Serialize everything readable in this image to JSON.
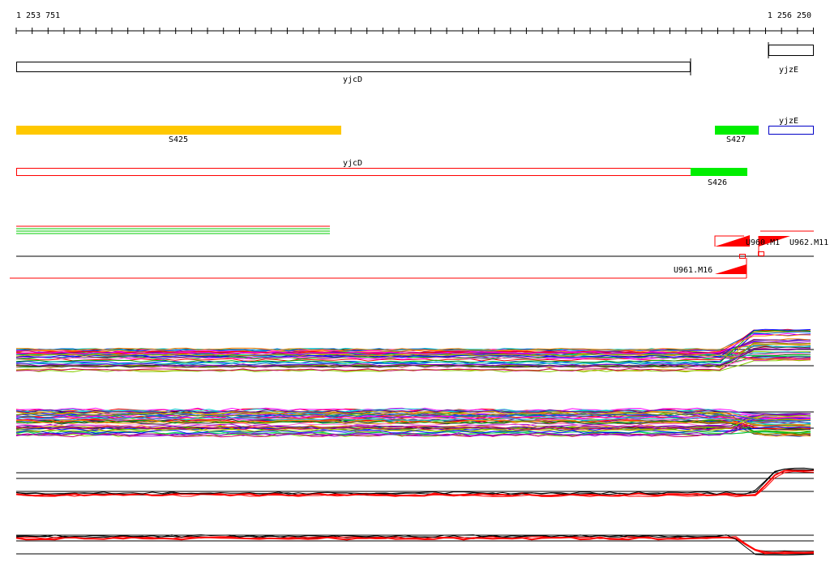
{
  "coordinates": {
    "start_label": "1 253 751",
    "end_label": "1 256 250"
  },
  "genes": {
    "top_yjcD": "yjcD",
    "top_yjzE": "yjzE",
    "yjzE_blue": "yjzE",
    "yjcD_red": "yjcD"
  },
  "segments": {
    "s425": "S425",
    "s426": "S426",
    "s427": "S427"
  },
  "probes": {
    "u960": "U960.M1",
    "u962": "U962.M11",
    "u961": "U961.M16"
  },
  "colors": {
    "orange_segment": "#ffc800",
    "green_segment": "#00ee00",
    "red_feature": "#ff0000",
    "blue_feature": "#0000c8",
    "black_line": "#000000"
  }
}
